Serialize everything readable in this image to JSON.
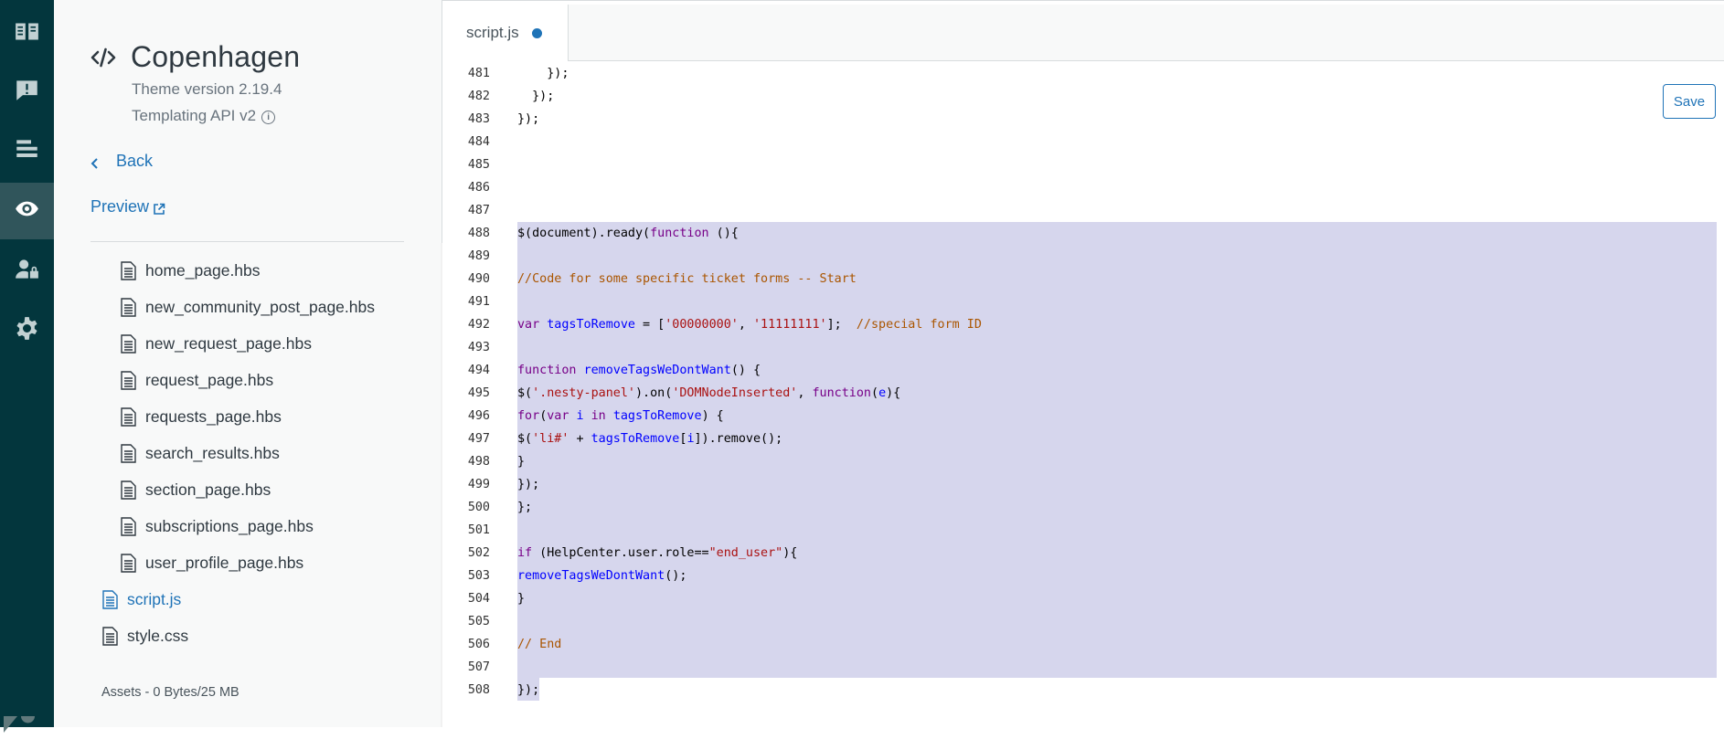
{
  "rail": {
    "items": [
      {
        "name": "guide-icon"
      },
      {
        "name": "feedback-icon"
      },
      {
        "name": "list-icon"
      },
      {
        "name": "eye-icon"
      },
      {
        "name": "user-permissions-icon"
      },
      {
        "name": "settings-gear-icon"
      }
    ],
    "active_index": 3
  },
  "theme": {
    "name": "Copenhagen",
    "version": "Theme version 2.19.4",
    "api": "Templating API v2",
    "back_label": "Back",
    "preview_label": "Preview",
    "assets_label": "Assets - 0 Bytes/25 MB"
  },
  "files": {
    "templates": [
      "home_page.hbs",
      "new_community_post_page.hbs",
      "new_request_page.hbs",
      "request_page.hbs",
      "requests_page.hbs",
      "search_results.hbs",
      "section_page.hbs",
      "subscriptions_page.hbs",
      "user_profile_page.hbs"
    ],
    "root": [
      "script.js",
      "style.css"
    ],
    "active": "script.js"
  },
  "editor": {
    "tab_label": "script.js",
    "tab_modified": true,
    "save_label": "Save",
    "selection_color": "#d6d6ed",
    "lines": [
      {
        "n": "481",
        "tokens": [
          [
            "",
            "    });"
          ]
        ]
      },
      {
        "n": "482",
        "tokens": [
          [
            "",
            "  });"
          ]
        ]
      },
      {
        "n": "483",
        "tokens": [
          [
            "",
            "});"
          ]
        ]
      },
      {
        "n": "484",
        "tokens": []
      },
      {
        "n": "485",
        "tokens": []
      },
      {
        "n": "486",
        "tokens": []
      },
      {
        "n": "487",
        "tokens": []
      },
      {
        "n": "488",
        "tokens": [
          [
            "",
            "$(document).ready("
          ],
          [
            "kw",
            "function"
          ],
          [
            "",
            " (){"
          ]
        ]
      },
      {
        "n": "489",
        "tokens": []
      },
      {
        "n": "490",
        "tokens": [
          [
            "cm",
            "//Code for some specific ticket forms -- Start"
          ]
        ]
      },
      {
        "n": "491",
        "tokens": []
      },
      {
        "n": "492",
        "tokens": [
          [
            "kw",
            "var"
          ],
          [
            "",
            " "
          ],
          [
            "def",
            "tagsToRemove"
          ],
          [
            "",
            " = ["
          ],
          [
            "str",
            "'00000000'"
          ],
          [
            "",
            ", "
          ],
          [
            "str",
            "'11111111'"
          ],
          [
            "",
            "];  "
          ],
          [
            "cm",
            "//special form ID"
          ]
        ]
      },
      {
        "n": "493",
        "tokens": []
      },
      {
        "n": "494",
        "tokens": [
          [
            "kw",
            "function"
          ],
          [
            "",
            " "
          ],
          [
            "def",
            "removeTagsWeDontWant"
          ],
          [
            "",
            "() {"
          ]
        ]
      },
      {
        "n": "495",
        "tokens": [
          [
            "",
            "$("
          ],
          [
            "str",
            "'.nesty-panel'"
          ],
          [
            "",
            ").on("
          ],
          [
            "str",
            "'DOMNodeInserted'"
          ],
          [
            "",
            ", "
          ],
          [
            "kw",
            "function"
          ],
          [
            "",
            "("
          ],
          [
            "def",
            "e"
          ],
          [
            "",
            "){"
          ]
        ]
      },
      {
        "n": "496",
        "tokens": [
          [
            "kw",
            "for"
          ],
          [
            "",
            "("
          ],
          [
            "kw",
            "var"
          ],
          [
            "",
            " "
          ],
          [
            "def",
            "i"
          ],
          [
            "",
            " "
          ],
          [
            "kw",
            "in"
          ],
          [
            "",
            " "
          ],
          [
            "var",
            "tagsToRemove"
          ],
          [
            "",
            ") {"
          ]
        ]
      },
      {
        "n": "497",
        "tokens": [
          [
            "",
            "$("
          ],
          [
            "str",
            "'li#'"
          ],
          [
            "",
            " + "
          ],
          [
            "var",
            "tagsToRemove"
          ],
          [
            "",
            "["
          ],
          [
            "var",
            "i"
          ],
          [
            "",
            "]).remove();"
          ]
        ]
      },
      {
        "n": "498",
        "tokens": [
          [
            "",
            "}"
          ]
        ]
      },
      {
        "n": "499",
        "tokens": [
          [
            "",
            "});"
          ]
        ]
      },
      {
        "n": "500",
        "tokens": [
          [
            "",
            "};"
          ]
        ]
      },
      {
        "n": "501",
        "tokens": []
      },
      {
        "n": "502",
        "tokens": [
          [
            "kw",
            "if"
          ],
          [
            "",
            " (HelpCenter.user.role=="
          ],
          [
            "str",
            "\"end_user\""
          ],
          [
            "",
            "){"
          ]
        ]
      },
      {
        "n": "503",
        "tokens": [
          [
            "var",
            "removeTagsWeDontWant"
          ],
          [
            "",
            "();"
          ]
        ]
      },
      {
        "n": "504",
        "tokens": [
          [
            "",
            "}"
          ]
        ]
      },
      {
        "n": "505",
        "tokens": []
      },
      {
        "n": "506",
        "tokens": [
          [
            "cm",
            "// End"
          ]
        ]
      },
      {
        "n": "507",
        "tokens": []
      },
      {
        "n": "508",
        "tokens": [
          [
            "",
            "});"
          ]
        ]
      }
    ]
  }
}
